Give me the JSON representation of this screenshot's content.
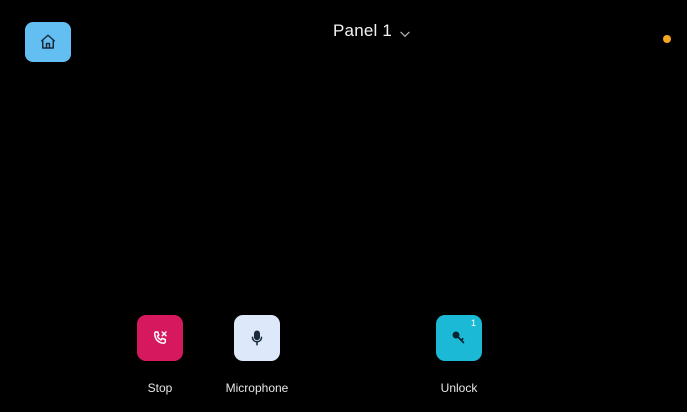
{
  "header": {
    "panel_name": "Panel 1",
    "panel_chevron_icon": "chevron-down-icon",
    "home_icon": "home-icon",
    "status_dot_color": "#f5a623"
  },
  "actions": [
    {
      "label": "Stop",
      "icon": "phone-hangup-icon",
      "color": "#d6195f"
    },
    {
      "label": "Microphone",
      "icon": "microphone-icon",
      "color": "#dde9fb"
    },
    {
      "label": "Unlock",
      "icon": "key-icon",
      "color": "#1cb9d6",
      "badge": "1"
    }
  ],
  "colors": {
    "background": "#000000",
    "home_button": "#63bff2"
  }
}
